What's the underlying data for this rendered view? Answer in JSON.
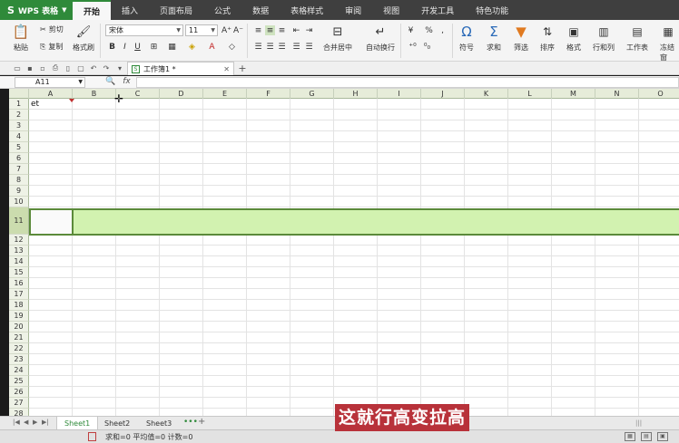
{
  "app": {
    "logo_label": "WPS 表格",
    "logo_glyph": "S",
    "menu_tabs": [
      "开始",
      "插入",
      "页面布局",
      "公式",
      "数据",
      "表格样式",
      "审阅",
      "视图",
      "开发工具",
      "特色功能"
    ]
  },
  "ribbon": {
    "paste": "粘贴",
    "cut": "剪切",
    "copy": "复制",
    "format_painter": "格式刷",
    "font_name": "宋体",
    "font_size": "11",
    "bold": "B",
    "italic": "I",
    "underline": "U",
    "merge_center": "合并居中",
    "wrap_text": "自动换行",
    "percent": "%",
    "symbol": "符号",
    "sum": "求和",
    "filter": "筛选",
    "sort": "排序",
    "format": "格式",
    "rows_cols": "行和列",
    "worksheet": "工作表",
    "freeze": "冻结窗"
  },
  "document": {
    "tab_title": "工作簿1 *"
  },
  "formula_bar": {
    "cell_ref": "A11",
    "fx_label": "fx"
  },
  "sheet": {
    "columns": [
      "A",
      "B",
      "C",
      "D",
      "E",
      "F",
      "G",
      "H",
      "I",
      "J",
      "K",
      "L",
      "M",
      "N",
      "O"
    ],
    "rows": [
      "1",
      "2",
      "3",
      "4",
      "5",
      "6",
      "7",
      "8",
      "9",
      "10",
      "11",
      "12",
      "13",
      "14",
      "15",
      "16",
      "17",
      "18",
      "19",
      "20",
      "21",
      "22",
      "23",
      "24",
      "25",
      "26",
      "27",
      "28"
    ],
    "a1_value": "et",
    "selected_row": "11"
  },
  "sheet_tabs": [
    "Sheet1",
    "Sheet2",
    "Sheet3"
  ],
  "status": {
    "text": "求和=0   平均值=0   计数=0"
  },
  "subtitle": "这就行高变拉高",
  "colors": {
    "accent": "#2f8a3a",
    "row_highlight": "#d2f2b0",
    "subtitle_bg": "#b8323a"
  }
}
